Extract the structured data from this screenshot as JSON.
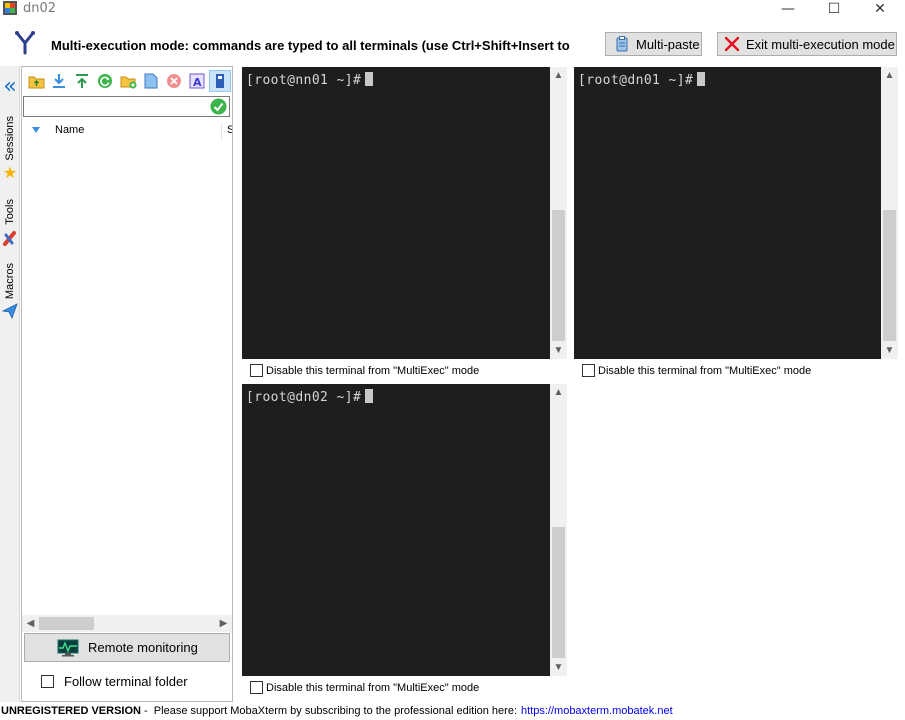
{
  "window": {
    "title": "dn02",
    "minimize_glyph": "—",
    "maximize_glyph": "☐",
    "close_glyph": "✕"
  },
  "multiexec": {
    "message": "Multi-execution mode: commands are typed to all terminals (use Ctrl+Shift+Insert to",
    "multipaste_label": "Multi-paste",
    "exit_label": "Exit multi-execution mode"
  },
  "vtabs": {
    "collapse_glyph": "«",
    "sessions_label": "Sessions",
    "tools_label": "Tools",
    "macros_label": "Macros"
  },
  "sidebar": {
    "path_value": "",
    "columns": {
      "name": "Name",
      "size": "S"
    },
    "remote_monitoring_label": "Remote monitoring",
    "follow_terminal_label": "Follow terminal folder",
    "follow_terminal_checked": false
  },
  "terminals": [
    {
      "prompt": "[root@nn01 ~]#",
      "disable_label": "Disable this terminal from \"MultiExec\" mode"
    },
    {
      "prompt": "[root@dn01 ~]#",
      "disable_label": "Disable this terminal from \"MultiExec\" mode"
    },
    {
      "prompt": "[root@dn02 ~]#",
      "disable_label": "Disable this terminal from \"MultiExec\" mode"
    }
  ],
  "status": {
    "bold_text": "UNREGISTERED VERSION",
    "message": " -  Please support MobaXterm by subscribing to the professional edition here:",
    "link_text": "https://mobaxterm.mobatek.net"
  },
  "colors": {
    "terminal_bg": "#1e1e1e",
    "link": "#0000ee",
    "exit_icon": "#e81123"
  }
}
